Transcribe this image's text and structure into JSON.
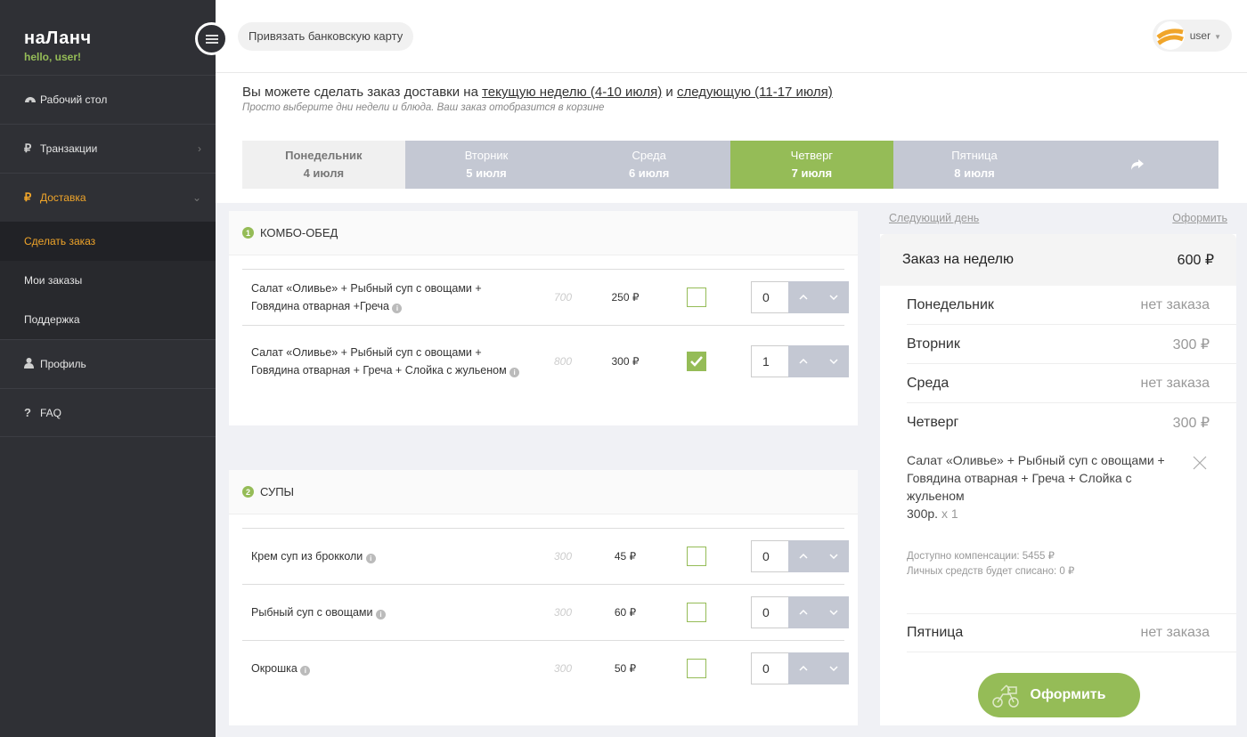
{
  "brand": {
    "name": "наЛанч",
    "hello": "hello, user!"
  },
  "sidebar": {
    "items": [
      {
        "label": "Рабочий стол",
        "icon": "dashboard-icon"
      },
      {
        "label": "Транзакции",
        "icon": "ruble-icon"
      },
      {
        "label": "Доставка",
        "icon": "ruble-icon"
      },
      {
        "label": "Профиль",
        "icon": "user-icon"
      },
      {
        "label": "FAQ",
        "icon": "question-icon"
      }
    ],
    "submenu": [
      {
        "label": "Сделать заказ"
      },
      {
        "label": "Мои заказы"
      },
      {
        "label": "Поддержка"
      }
    ]
  },
  "header": {
    "bind_card": "Привязать банковскую карту",
    "user": "user"
  },
  "intro": {
    "prefix": "Вы можете сделать заказ доставки на",
    "week1": "текущую неделю (4-10 июля)",
    "and": "и",
    "week2": "следующую (11-17 июля)",
    "sub": "Просто выберите дни недели и блюда. Ваш заказ отобразится в корзине"
  },
  "days": [
    {
      "name": "Понедельник",
      "date": "4 июля"
    },
    {
      "name": "Вторник",
      "date": "5 июля"
    },
    {
      "name": "Среда",
      "date": "6 июля"
    },
    {
      "name": "Четверг",
      "date": "7 июля"
    },
    {
      "name": "Пятница",
      "date": "8 июля"
    }
  ],
  "sections": [
    {
      "num": "1",
      "title": "КОМБО-ОБЕД",
      "items": [
        {
          "name": "Салат «Оливье» + Рыбный суп с овощами + Говядина отварная +Греча",
          "old": "700",
          "price": "250 ₽",
          "checked": false,
          "qty": "0"
        },
        {
          "name": "Салат «Оливье» + Рыбный суп с овощами + Говядина отварная + Греча + Слойка с жульеном",
          "old": "800",
          "price": "300 ₽",
          "checked": true,
          "qty": "1"
        }
      ]
    },
    {
      "num": "2",
      "title": "СУПЫ",
      "items": [
        {
          "name": "Крем суп из брокколи",
          "old": "300",
          "price": "45 ₽",
          "checked": false,
          "qty": "0"
        },
        {
          "name": "Рыбный суп с овощами",
          "old": "300",
          "price": "60 ₽",
          "checked": false,
          "qty": "0"
        },
        {
          "name": "Окрошка",
          "old": "300",
          "price": "50 ₽",
          "checked": false,
          "qty": "0"
        }
      ]
    }
  ],
  "cart": {
    "next_day": "Следующий день",
    "checkout_link": "Оформить",
    "title": "Заказ на неделю",
    "total": "600 ₽",
    "days": [
      {
        "name": "Понедельник",
        "sum": "нет заказа"
      },
      {
        "name": "Вторник",
        "sum": "300 ₽"
      },
      {
        "name": "Среда",
        "sum": "нет заказа"
      },
      {
        "name": "Четверг",
        "sum": "300 ₽"
      },
      {
        "name": "Пятница",
        "sum": "нет заказа"
      }
    ],
    "item": {
      "name": "Салат «Оливье» + Рыбный суп с овощами + Говядина отварная + Греча + Слойка с жульеном",
      "price": "300р.",
      "qty": "x 1"
    },
    "compensation": "Доступно компенсации: 5455 ₽",
    "personal": "Личных средств будет списано: 0 ₽",
    "order_button": "Оформить"
  },
  "colors": {
    "accent": "#95bc57",
    "orange": "#f0a52a",
    "sidebar": "#2f3035",
    "tab": "#c4c8d3"
  }
}
